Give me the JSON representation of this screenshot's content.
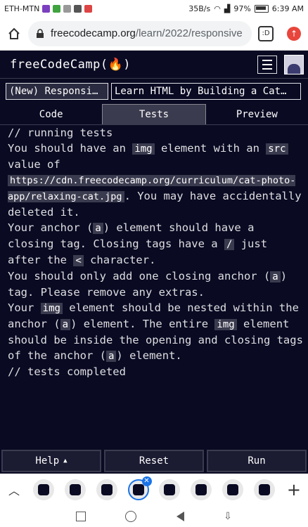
{
  "status": {
    "carrier": "ETH-MTN",
    "speed": "35B/s",
    "battery": "97%",
    "time": "6:39 AM"
  },
  "browser": {
    "url_host": "freecodecamp.org",
    "url_path": "/learn/2022/responsive",
    "tab_count": ":D"
  },
  "nav": {
    "logo": "freeCodeCamp(🔥)"
  },
  "breadcrumb": {
    "course": "(New) Responsi…",
    "lesson": "Learn HTML by Building a Cat…"
  },
  "tabs": [
    {
      "label": "Code",
      "active": false
    },
    {
      "label": "Tests",
      "active": true
    },
    {
      "label": "Preview",
      "active": false
    }
  ],
  "output": {
    "running": "// running tests",
    "t1_a": "You should have an ",
    "t1_code1": "img",
    "t1_b": " element with an ",
    "t1_code2": "src",
    "t1_c": " value of ",
    "t1_url": "https://cdn.freecodecamp.org/curriculum/cat-photo-app/relaxing-cat.jpg",
    "t1_d": ". You may have accidentally deleted it.",
    "t2_a": "Your anchor (",
    "t2_code1": "a",
    "t2_b": ") element should have a closing tag. Closing tags have a ",
    "t2_code2": "/",
    "t2_c": " just after the ",
    "t2_code3": "<",
    "t2_d": " character.",
    "t3_a": "You should only add one closing anchor (",
    "t3_code1": "a",
    "t3_b": ") tag. Please remove any extras.",
    "t4_a": "Your ",
    "t4_code1": "img",
    "t4_b": " element should be nested within the anchor (",
    "t4_code2": "a",
    "t4_c": ") element. The entire ",
    "t4_code3": "img",
    "t4_d": " element should be inside the opening and closing tags of the anchor (",
    "t4_code4": "a",
    "t4_e": ") element.",
    "completed": "// tests completed"
  },
  "actions": {
    "help": "Help",
    "reset": "Reset",
    "run": "Run"
  },
  "tab_strip": {
    "thumb_count": 8,
    "active_index": 3
  }
}
